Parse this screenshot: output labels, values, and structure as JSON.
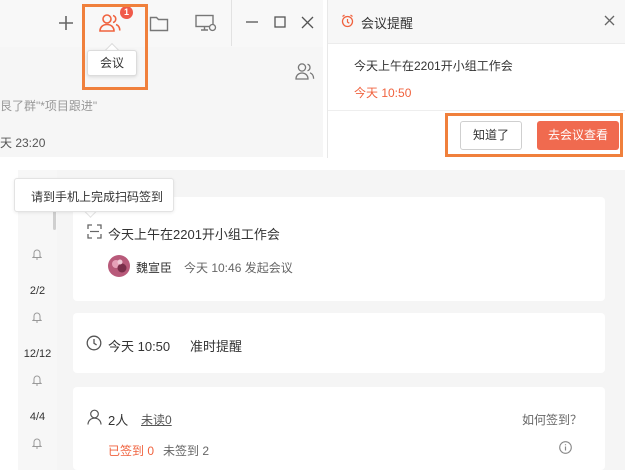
{
  "toolbar": {
    "add_icon": "plus-icon",
    "meeting_icon": "people-icon",
    "meeting_badge": "1",
    "meeting_tooltip": "会议",
    "folder_icon": "folder-icon",
    "device_icon": "monitor-settings-icon",
    "window_controls": [
      "minimize-icon",
      "maximize-icon",
      "close-icon"
    ]
  },
  "chat": {
    "members_icon": "people-icon",
    "last_message": "艮了群\"*项目跟进\"",
    "last_time": "天 23:20"
  },
  "reminder": {
    "title": "会议提醒",
    "message": "今天上午在2201开小组工作会",
    "time": "今天 10:50",
    "ok_label": "知道了",
    "view_label": "去会议查看"
  },
  "checkin_tip": "请到手机上完成扫码签到",
  "timeline_counts": [
    "2/2",
    "12/12",
    "4/4"
  ],
  "meeting_card": {
    "title": "今天上午在2201开小组工作会",
    "organizer": "魏宣臣",
    "start_info": "今天 10:46 发起会议"
  },
  "reminder_card": {
    "time": "今天 10:50",
    "type": "准时提醒"
  },
  "attendance_card": {
    "total": "2人",
    "unread": "未读0",
    "help_link": "如何签到？",
    "signed": "已签到 0",
    "unsigned": "未签到 2"
  },
  "colors": {
    "accent": "#f0623e",
    "primary_button": "#f06a4f",
    "highlight_box": "#f0803c",
    "badge": "#f05a4a"
  }
}
